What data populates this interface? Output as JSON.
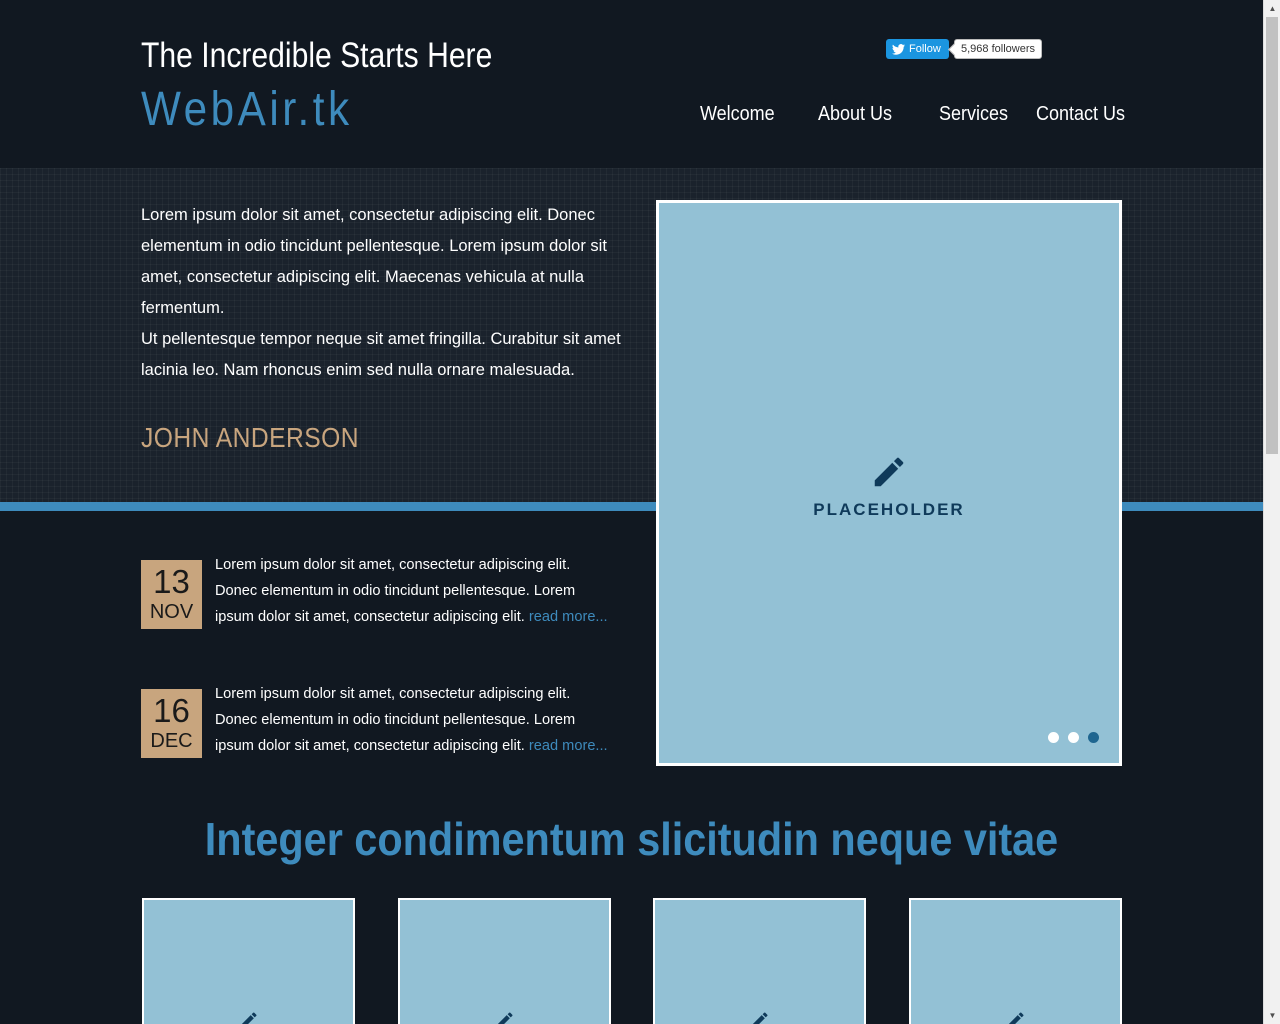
{
  "header": {
    "tagline": "The Incredible Starts Here",
    "logo": "WebAir.tk",
    "twitter": {
      "follow_label": "Follow",
      "followers_label": "5,968 followers"
    },
    "nav": [
      "Welcome",
      "About Us",
      "Services",
      "Contact Us"
    ]
  },
  "intro": {
    "paragraph1": "Lorem ipsum dolor sit amet, consectetur adipiscing elit. Donec elementum in odio tincidunt pellentesque. Lorem ipsum dolor sit amet, consectetur adipiscing elit. Maecenas vehicula at nulla fermentum.",
    "paragraph2": "Ut pellentesque tempor neque sit amet fringilla. Curabitur sit amet lacinia leo. Nam rhoncus enim sed nulla ornare malesuada.",
    "signature": "JOHN ANDERSON"
  },
  "slider": {
    "placeholder_label": "PLACEHOLDER",
    "icon": "pencil-icon",
    "slide_count": 3,
    "active_slide": 3
  },
  "news": [
    {
      "day": "13",
      "month": "NOV",
      "text": "Lorem ipsum dolor sit amet, consectetur adipiscing elit. Donec elementum in odio tincidunt pellentesque. Lorem ipsum dolor sit amet, consectetur adipiscing elit.",
      "link": "read more..."
    },
    {
      "day": "16",
      "month": "DEC",
      "text": "Lorem ipsum dolor sit amet, consectetur adipiscing elit. Donec elementum in odio tincidunt pellentesque. Lorem ipsum dolor sit amet, consectetur adipiscing elit.",
      "link": "read more..."
    }
  ],
  "section": {
    "title": "Integer condimentum slicitudin neque vitae"
  },
  "colors": {
    "background": "#111821",
    "accent_blue": "#3e8bbd",
    "accent_tan": "#c8a57e",
    "placeholder_bg": "#93c1d5"
  }
}
